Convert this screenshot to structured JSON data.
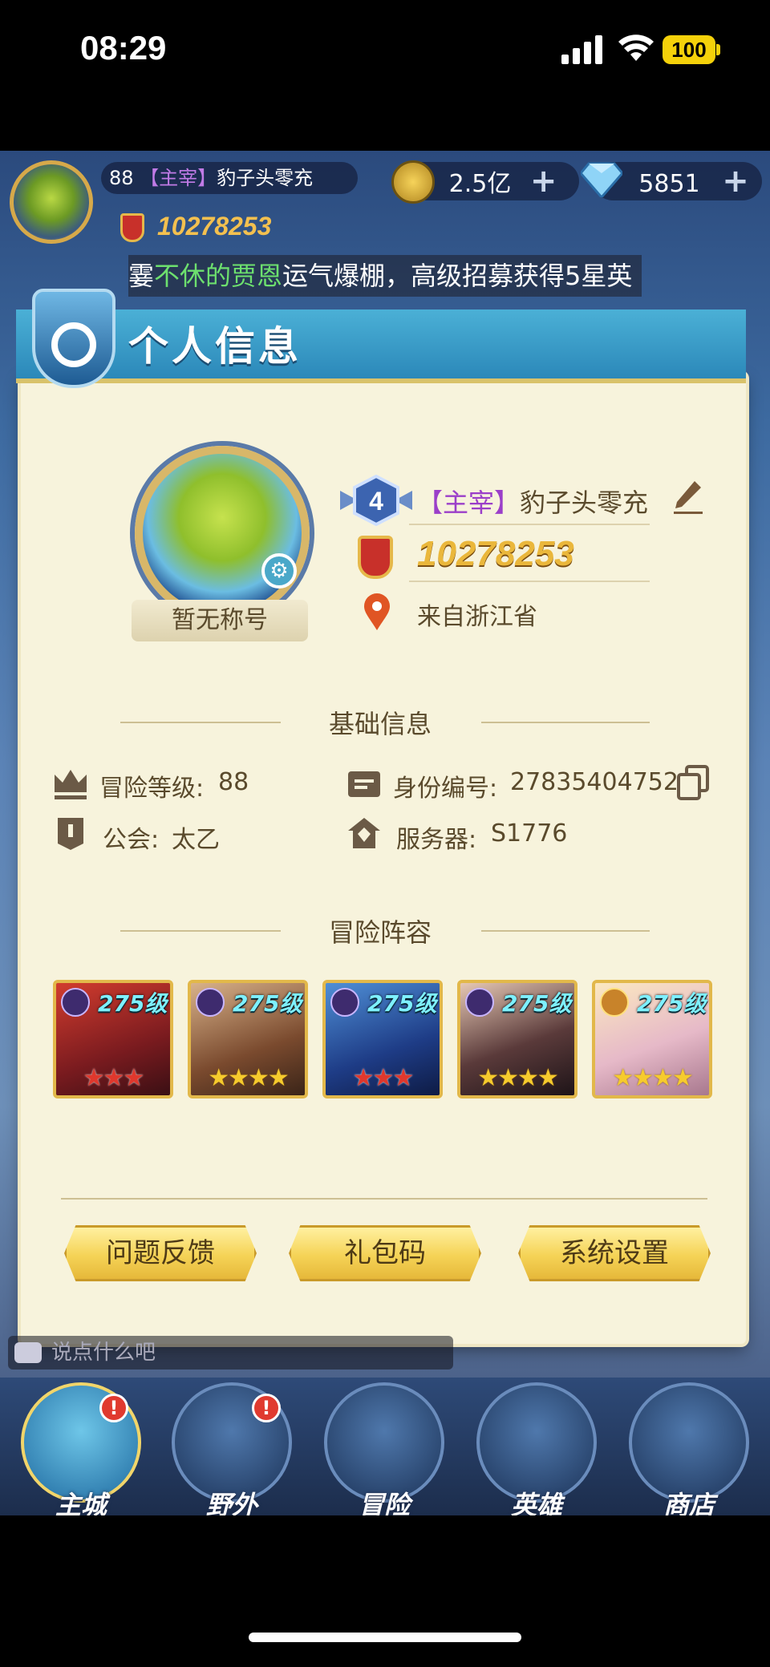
{
  "status_bar": {
    "time": "08:29",
    "battery": "100"
  },
  "hud": {
    "level": "88",
    "title_tag": "【主宰】",
    "player_name": "豹子头零充",
    "power": "10278253",
    "gold": "2.5亿",
    "gems": "5851",
    "plus": "+",
    "ticker_prefix": "霎",
    "ticker_highlight": "不休的贾恩",
    "ticker_rest": "运气爆棚，高级招募获得5星英"
  },
  "panel": {
    "title": "个人信息",
    "no_title": "暂无称号",
    "vip_level": "4",
    "title_tag": "【主宰】",
    "player_name": "豹子头零充",
    "power": "10278253",
    "from": "来自浙江省",
    "basic_section": "基础信息",
    "adventure_level_label": "冒险等级:",
    "adventure_level": "88",
    "id_label": "身份编号:",
    "id_value": "27835404752",
    "guild_label": "公会:",
    "guild_value": "太乙",
    "server_label": "服务器:",
    "server_value": "S1776",
    "lineup_section": "冒险阵容",
    "heroes": [
      {
        "level": "275级",
        "stars": "★★★",
        "star_color": "red",
        "badge": "purple"
      },
      {
        "level": "275级",
        "stars": "★★★★",
        "star_color": "gold",
        "badge": "purple"
      },
      {
        "level": "275级",
        "stars": "★★★",
        "star_color": "red",
        "badge": "purple"
      },
      {
        "level": "275级",
        "stars": "★★★★",
        "star_color": "gold",
        "badge": "purple"
      },
      {
        "level": "275级",
        "stars": "★★★★",
        "star_color": "gold",
        "badge": "gold"
      }
    ],
    "buttons": {
      "feedback": "问题反馈",
      "gift_code": "礼包码",
      "settings": "系统设置"
    }
  },
  "chat": {
    "placeholder": "说点什么吧"
  },
  "nav": [
    {
      "label": "主城",
      "alert": "!"
    },
    {
      "label": "野外",
      "alert": "!"
    },
    {
      "label": "冒险"
    },
    {
      "label": "英雄"
    },
    {
      "label": "商店"
    }
  ],
  "colors": {
    "accent_blue": "#2b88b9",
    "panel_bg": "#f7f3dc",
    "gold": "#eab73b",
    "button_yellow": "#f5d356",
    "purple_tag": "#9b3fc9"
  }
}
